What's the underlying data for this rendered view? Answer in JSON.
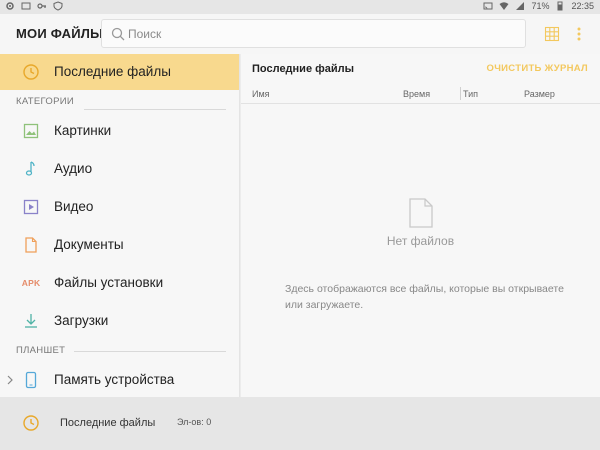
{
  "status_bar": {
    "battery": "71%",
    "time": "22:35",
    "left_icons": [
      "gear-icon",
      "screen-icon",
      "key-icon",
      "shield-icon"
    ],
    "right_icons": [
      "cast-icon",
      "wifi-icon",
      "signal-icon",
      "battery-icon"
    ]
  },
  "toolbar": {
    "title": "МОИ ФАЙЛЫ",
    "search_placeholder": "Поиск"
  },
  "sidebar": {
    "top_item": {
      "label": "Последние файлы",
      "icon": "clock-icon"
    },
    "categories_header": "КАТЕГОРИИ",
    "categories": [
      {
        "label": "Картинки",
        "icon": "image-icon"
      },
      {
        "label": "Аудио",
        "icon": "music-note-icon"
      },
      {
        "label": "Видео",
        "icon": "video-icon"
      },
      {
        "label": "Документы",
        "icon": "document-icon"
      },
      {
        "label": "Файлы установки",
        "icon": "apk-icon",
        "icon_text": "APK"
      },
      {
        "label": "Загрузки",
        "icon": "download-icon"
      }
    ],
    "tablet_header": "ПЛАНШЕТ",
    "tablet_items": [
      {
        "label": "Память устройства",
        "icon": "phone-icon"
      }
    ]
  },
  "main": {
    "title": "Последние файлы",
    "clear_label": "ОЧИСТИТЬ ЖУРНАЛ",
    "columns": [
      "Имя",
      "Время",
      "Тип",
      "Размер"
    ],
    "empty_title": "Нет файлов",
    "empty_desc": "Здесь отображаются все файлы, которые вы открываете или загружаете."
  },
  "bottom_bar": {
    "title": "Последние файлы",
    "count": "Эл-ов: 0"
  },
  "colors": {
    "accent": "#f3c85e",
    "active_bg": "#f8d98e",
    "image": "#8fc27a",
    "audio": "#4fb3c6",
    "video": "#8a82c9",
    "document": "#f0a05a",
    "apk": "#e58c6a",
    "download": "#4fb3a6",
    "device": "#55a8d8"
  }
}
